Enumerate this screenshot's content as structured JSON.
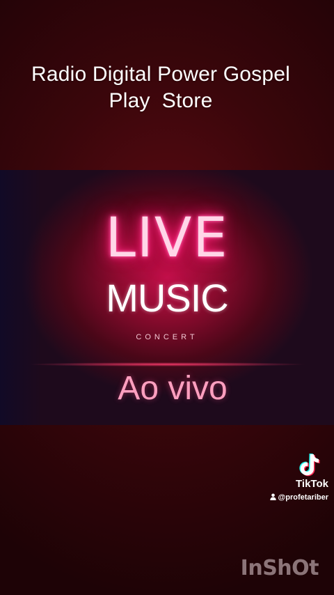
{
  "header": {
    "title_line1": "Radio Digital Power Gospel",
    "title_line2": "Play  Store"
  },
  "banner": {
    "neon_text": "LIVE",
    "music_text": "MUSIC",
    "concert_text": "CONCERT",
    "caption": "Ao vivo"
  },
  "overlay": {
    "app_name": "TikTok",
    "username": "@profetariber",
    "watermark": "InShOt"
  },
  "colors": {
    "background": "#3a060b",
    "banner_glow": "#c2104a",
    "neon_pink": "#ff2d88",
    "caption_pink": "#ff9fbf"
  },
  "icons": {
    "tiktok": "tiktok-logo-icon",
    "user": "user-icon"
  }
}
